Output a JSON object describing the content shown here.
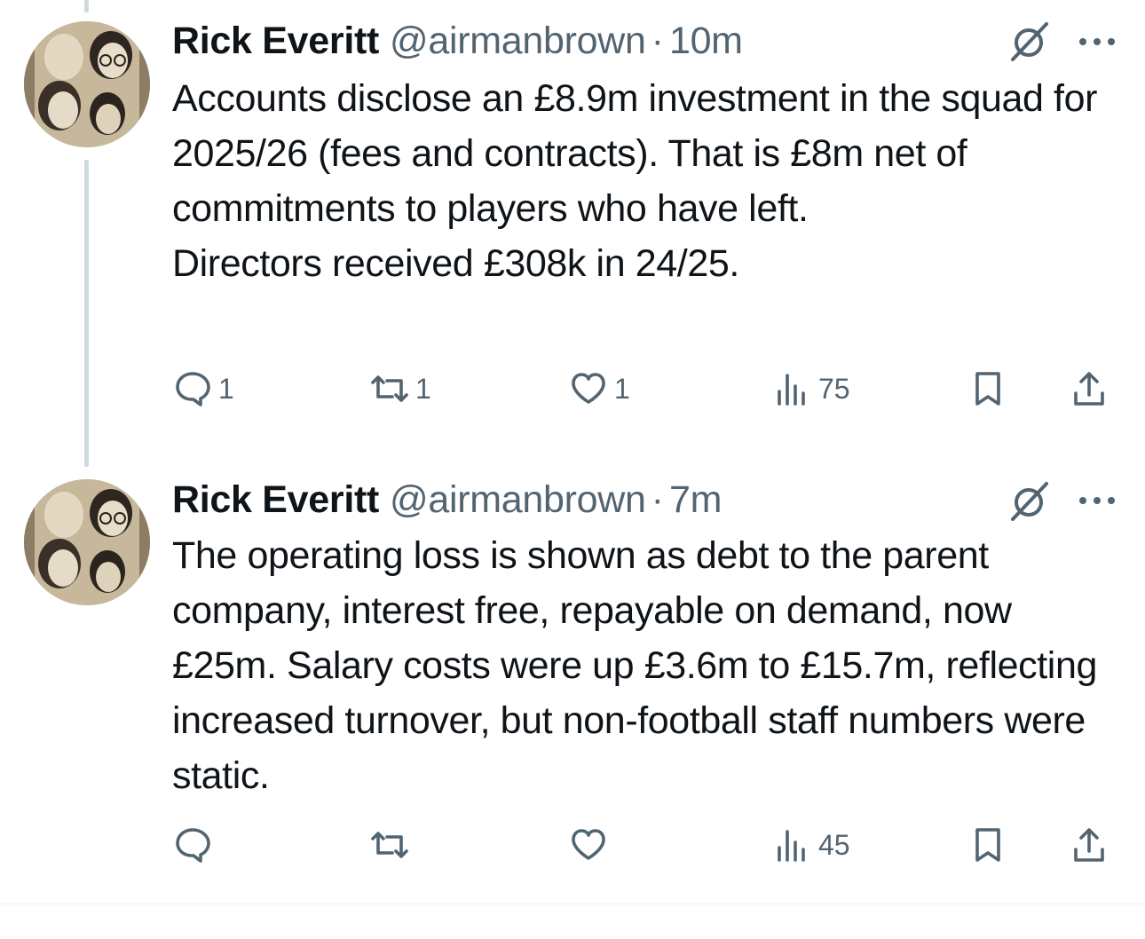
{
  "tweets": [
    {
      "author_name": "Rick Everitt",
      "handle": "@airmanbrown",
      "separator": "·",
      "time": "10m",
      "text": "Accounts disclose an £8.9m investment in the squad for 2025/26 (fees and contracts). That is £8m net of commitments to players who have left.\nDirectors received £308k in 24/25.",
      "reply_count": "1",
      "retweet_count": "1",
      "like_count": "1",
      "view_count": "75"
    },
    {
      "author_name": "Rick Everitt",
      "handle": "@airmanbrown",
      "separator": "·",
      "time": "7m",
      "text": "The operating loss is shown as debt to the parent company, interest free, repayable on demand, now £25m. Salary costs were up £3.6m to £15.7m, reflecting increased turnover, but non-football staff numbers were static.",
      "reply_count": "",
      "retweet_count": "",
      "like_count": "",
      "view_count": "45"
    }
  ],
  "icons": {
    "reply": "reply-icon",
    "retweet": "retweet-icon",
    "like": "heart-icon",
    "views": "views-icon",
    "bookmark": "bookmark-icon",
    "share": "share-icon",
    "grok": "grok-icon",
    "more": "more-icon"
  },
  "colors": {
    "text": "#0f1419",
    "secondary": "#536471",
    "thread_line": "#cfd9de"
  }
}
